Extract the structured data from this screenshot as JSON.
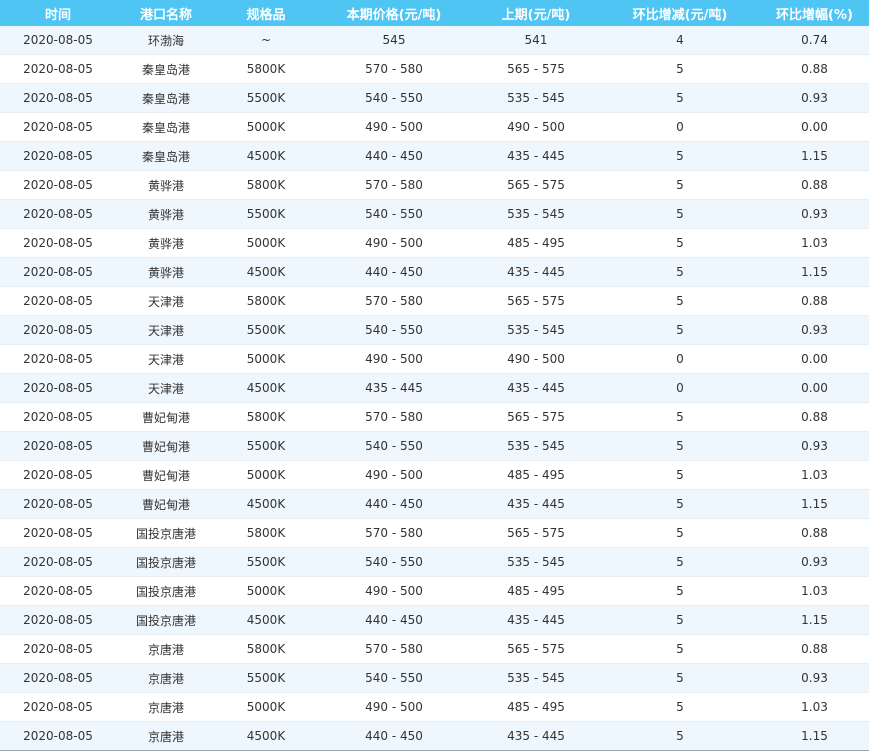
{
  "table": {
    "headers": [
      "时间",
      "港口名称",
      "规格品",
      "本期价格(元/吨)",
      "上期(元/吨)",
      "环比增减(元/吨)",
      "环比增幅(%)"
    ],
    "rows": [
      [
        "2020-08-05",
        "环渤海",
        "~",
        "545",
        "541",
        "4",
        "0.74"
      ],
      [
        "2020-08-05",
        "秦皇岛港",
        "5800K",
        "570 - 580",
        "565 - 575",
        "5",
        "0.88"
      ],
      [
        "2020-08-05",
        "秦皇岛港",
        "5500K",
        "540 - 550",
        "535 - 545",
        "5",
        "0.93"
      ],
      [
        "2020-08-05",
        "秦皇岛港",
        "5000K",
        "490 - 500",
        "490 - 500",
        "0",
        "0.00"
      ],
      [
        "2020-08-05",
        "秦皇岛港",
        "4500K",
        "440 - 450",
        "435 - 445",
        "5",
        "1.15"
      ],
      [
        "2020-08-05",
        "黄骅港",
        "5800K",
        "570 - 580",
        "565 - 575",
        "5",
        "0.88"
      ],
      [
        "2020-08-05",
        "黄骅港",
        "5500K",
        "540 - 550",
        "535 - 545",
        "5",
        "0.93"
      ],
      [
        "2020-08-05",
        "黄骅港",
        "5000K",
        "490 - 500",
        "485 - 495",
        "5",
        "1.03"
      ],
      [
        "2020-08-05",
        "黄骅港",
        "4500K",
        "440 - 450",
        "435 - 445",
        "5",
        "1.15"
      ],
      [
        "2020-08-05",
        "天津港",
        "5800K",
        "570 - 580",
        "565 - 575",
        "5",
        "0.88"
      ],
      [
        "2020-08-05",
        "天津港",
        "5500K",
        "540 - 550",
        "535 - 545",
        "5",
        "0.93"
      ],
      [
        "2020-08-05",
        "天津港",
        "5000K",
        "490 - 500",
        "490 - 500",
        "0",
        "0.00"
      ],
      [
        "2020-08-05",
        "天津港",
        "4500K",
        "435 - 445",
        "435 - 445",
        "0",
        "0.00"
      ],
      [
        "2020-08-05",
        "曹妃甸港",
        "5800K",
        "570 - 580",
        "565 - 575",
        "5",
        "0.88"
      ],
      [
        "2020-08-05",
        "曹妃甸港",
        "5500K",
        "540 - 550",
        "535 - 545",
        "5",
        "0.93"
      ],
      [
        "2020-08-05",
        "曹妃甸港",
        "5000K",
        "490 - 500",
        "485 - 495",
        "5",
        "1.03"
      ],
      [
        "2020-08-05",
        "曹妃甸港",
        "4500K",
        "440 - 450",
        "435 - 445",
        "5",
        "1.15"
      ],
      [
        "2020-08-05",
        "国投京唐港",
        "5800K",
        "570 - 580",
        "565 - 575",
        "5",
        "0.88"
      ],
      [
        "2020-08-05",
        "国投京唐港",
        "5500K",
        "540 - 550",
        "535 - 545",
        "5",
        "0.93"
      ],
      [
        "2020-08-05",
        "国投京唐港",
        "5000K",
        "490 - 500",
        "485 - 495",
        "5",
        "1.03"
      ],
      [
        "2020-08-05",
        "国投京唐港",
        "4500K",
        "440 - 450",
        "435 - 445",
        "5",
        "1.15"
      ],
      [
        "2020-08-05",
        "京唐港",
        "5800K",
        "570 - 580",
        "565 - 575",
        "5",
        "0.88"
      ],
      [
        "2020-08-05",
        "京唐港",
        "5500K",
        "540 - 550",
        "535 - 545",
        "5",
        "0.93"
      ],
      [
        "2020-08-05",
        "京唐港",
        "5000K",
        "490 - 500",
        "485 - 495",
        "5",
        "1.03"
      ],
      [
        "2020-08-05",
        "京唐港",
        "4500K",
        "440 - 450",
        "435 - 445",
        "5",
        "1.15"
      ]
    ]
  },
  "colors": {
    "header_bg": "#4fc5f4",
    "header_text": "#ffffff",
    "row_alt_bg": "#eef7fd",
    "cell_text": "#333333"
  }
}
